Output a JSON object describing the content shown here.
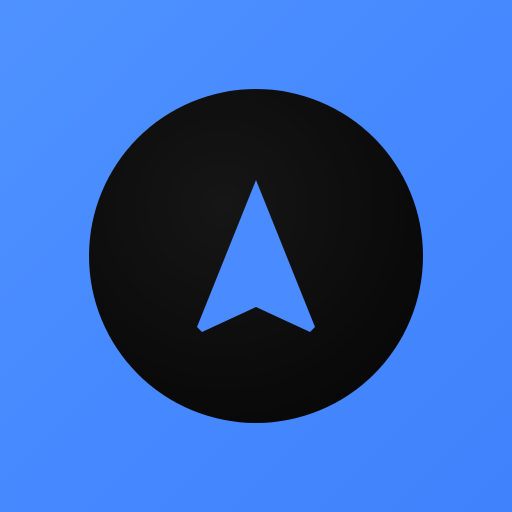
{
  "icon": {
    "name": "navigation-arrow-icon",
    "background_color": "#4a8bff",
    "badge_color": "#0b0b0b",
    "arrow_color": "#4a8bff"
  }
}
